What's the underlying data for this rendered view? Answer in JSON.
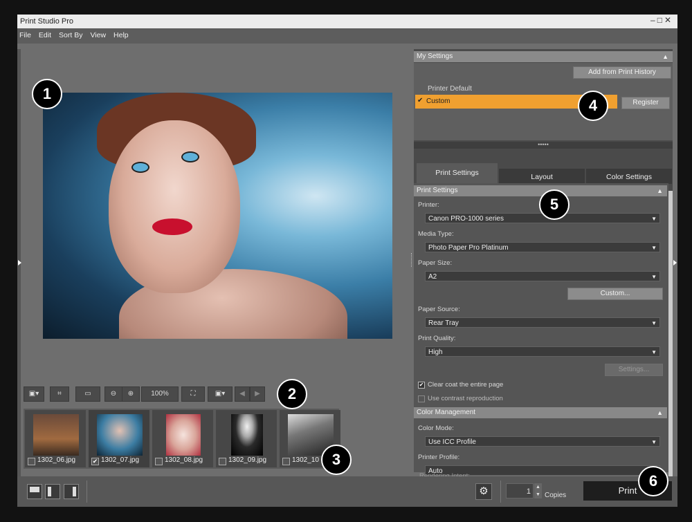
{
  "window": {
    "title": "Print Studio Pro",
    "controls": "‒□✕"
  },
  "menu": [
    "File",
    "Edit",
    "Sort By",
    "View",
    "Help"
  ],
  "toolbar": {
    "zoom": "100%",
    "prev": "◀",
    "next": "▶"
  },
  "thumbnails": [
    {
      "name": "1302_06.jpg",
      "checked": false
    },
    {
      "name": "1302_07.jpg",
      "checked": true
    },
    {
      "name": "1302_08.jpg",
      "checked": false
    },
    {
      "name": "1302_09.jpg",
      "checked": false
    },
    {
      "name": "1302_10",
      "checked": false
    }
  ],
  "my_settings": {
    "header": "My Settings",
    "add_history_button": "Add from Print History",
    "items": [
      "Printer Default",
      "Custom"
    ],
    "selected_check": "✔",
    "register_button": "Register"
  },
  "tabs": [
    "Print Settings",
    "Layout",
    "Color Settings"
  ],
  "print_settings": {
    "header": "Print Settings",
    "printer_label": "Printer:",
    "printer_value": "Canon PRO-1000 series",
    "media_label": "Media Type:",
    "media_value": "Photo Paper Pro Platinum",
    "paper_size_label": "Paper Size:",
    "paper_size_value": "A2",
    "custom_button": "Custom...",
    "paper_source_label": "Paper Source:",
    "paper_source_value": "Rear Tray",
    "quality_label": "Print Quality:",
    "quality_value": "High",
    "settings_button": "Settings...",
    "clear_coat": "Clear coat the entire page",
    "contrast": "Use contrast reproduction"
  },
  "color_management": {
    "header": "Color Management",
    "mode_label": "Color Mode:",
    "mode_value": "Use ICC Profile",
    "profile_label": "Printer Profile:",
    "profile_value": "Auto",
    "rendering_label": "Rendering Intent:"
  },
  "bottom": {
    "copies_value": "1",
    "copies_label": "Copies",
    "print_button": "Print"
  },
  "markers": [
    "1",
    "2",
    "3",
    "4",
    "5",
    "6"
  ],
  "colors": {
    "highlight": "#f0a030",
    "panel": "#4a4a4a",
    "background": "#6e6e6e"
  }
}
